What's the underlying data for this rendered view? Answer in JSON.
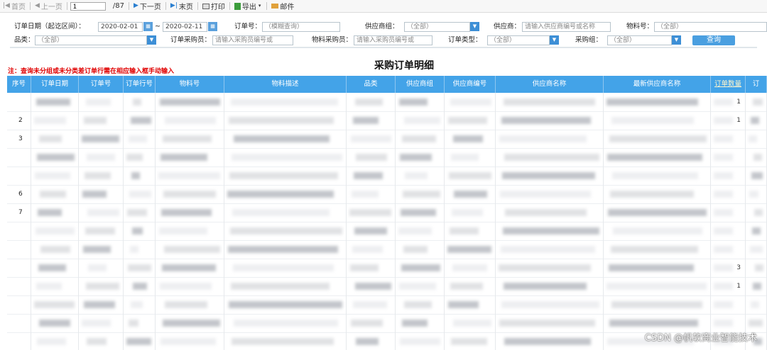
{
  "toolbar": {
    "first": "首页",
    "prev": "上一页",
    "page_value": "1",
    "page_total": "/87",
    "next": "下一页",
    "last": "末页",
    "print": "打印",
    "export": "导出",
    "mail": "邮件"
  },
  "filters": {
    "date_label": "订单日期（起讫区间）：",
    "date_from": "2020-02-01",
    "date_to": "2020-02-11",
    "tilde": "~",
    "order_no_label": "订单号：",
    "order_no_placeholder": "（模糊查询）",
    "supplier_group_label": "供应商组：",
    "supplier_group_value": "（全部）",
    "supplier_label": "供应商：",
    "supplier_placeholder": "请输入供应商编号或名称",
    "material_no_label": "物料号：",
    "material_no_value": "（全部）",
    "category_label": "品类：",
    "category_value": "（全部）",
    "order_buyer_label": "订单采购员：",
    "order_buyer_placeholder": "请输入采购员编号或",
    "material_buyer_label": "物料采购员：",
    "material_buyer_placeholder": "请输入采购员编号或",
    "order_type_label": "订单类型：",
    "order_type_value": "（全部）",
    "purchase_group_label": "采购组：",
    "purchase_group_value": "（全部）",
    "query_button": "查询"
  },
  "note": "注：查询未分组或未分类差订单行需在相应输入框手动输入",
  "title": "采购订单明细",
  "table": {
    "headers": [
      "序号",
      "订单日期",
      "订单号",
      "订单行号",
      "物料号",
      "物料描述",
      "品类",
      "供应商组",
      "供应商编号",
      "供应商名称",
      "最新供应商名称",
      "订单数量",
      "订"
    ],
    "rows": [
      {
        "seq": "",
        "qty": "1"
      },
      {
        "seq": "2",
        "qty": "1"
      },
      {
        "seq": "3",
        "qty": ""
      },
      {
        "seq": "",
        "qty": ""
      },
      {
        "seq": "",
        "qty": ""
      },
      {
        "seq": "6",
        "qty": ""
      },
      {
        "seq": "7",
        "qty": ""
      },
      {
        "seq": "",
        "qty": ""
      },
      {
        "seq": "",
        "qty": ""
      },
      {
        "seq": "",
        "qty": "3"
      },
      {
        "seq": "",
        "qty": "1"
      },
      {
        "seq": "",
        "qty": ""
      },
      {
        "seq": "",
        "qty": ""
      },
      {
        "seq": "",
        "qty": ""
      }
    ]
  },
  "watermark": "CSDN @帆软商业智能技术"
}
